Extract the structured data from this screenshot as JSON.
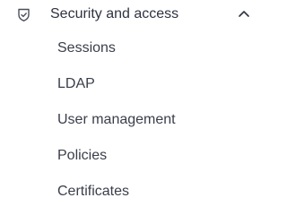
{
  "group": {
    "icon": "shield-check-icon",
    "label": "Security and access",
    "expanded": true,
    "toggle_icon": "chevron-up-icon"
  },
  "items": [
    {
      "label": "Sessions"
    },
    {
      "label": "LDAP"
    },
    {
      "label": "User management"
    },
    {
      "label": "Policies"
    },
    {
      "label": "Certificates"
    }
  ],
  "colors": {
    "text": "#2f3341",
    "icon": "#4a4f5c",
    "background": "#ffffff"
  }
}
